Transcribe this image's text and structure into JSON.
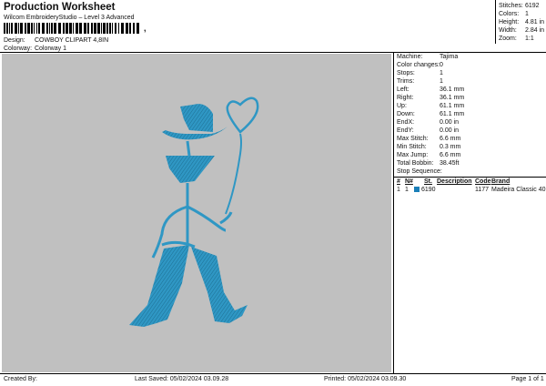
{
  "header": {
    "title": "Production Worksheet",
    "subtitle": "Wilcom EmbroideryStudio – Level 3 Advanced",
    "barcode_suffix": ","
  },
  "design": {
    "design_label": "Design:",
    "design_value": "COWBOY CLIPART 4,8IN",
    "colorway_label": "Colorway:",
    "colorway_value": "Colorway 1"
  },
  "stats": {
    "stitches_label": "Stitches:",
    "stitches_value": "6192",
    "colors_label": "Colors:",
    "colors_value": "1",
    "height_label": "Height:",
    "height_value": "4.81 in",
    "width_label": "Width:",
    "width_value": "2.84 in",
    "zoom_label": "Zoom:",
    "zoom_value": "1:1"
  },
  "info": [
    {
      "label": "Machine:",
      "value": "Tajima"
    },
    {
      "label": "Color changes:",
      "value": "0"
    },
    {
      "label": "Stops:",
      "value": "1"
    },
    {
      "label": "Trims:",
      "value": "1"
    },
    {
      "label": "Left:",
      "value": "36.1 mm"
    },
    {
      "label": "Right:",
      "value": "36.1 mm"
    },
    {
      "label": "Up:",
      "value": "61.1 mm"
    },
    {
      "label": "Down:",
      "value": "61.1 mm"
    },
    {
      "label": "EndX:",
      "value": "0.00 in"
    },
    {
      "label": "EndY:",
      "value": "0.00 in"
    },
    {
      "label": "Max Stitch:",
      "value": "6.6 mm"
    },
    {
      "label": "Min Stitch:",
      "value": "0.3 mm"
    },
    {
      "label": "Max Jump:",
      "value": "6.6 mm"
    },
    {
      "label": "Total Bobbin:",
      "value": "38.45ft"
    }
  ],
  "sequence": {
    "title": "Stop Sequence:",
    "headers": {
      "stop": "#",
      "n": "N#",
      "st": "St.",
      "description": "Description",
      "code": "Code",
      "brand": "Brand"
    },
    "rows": [
      {
        "stop": "1",
        "n": "1",
        "color": "#1a7fb8",
        "st": "6190",
        "description": "",
        "code": "1177",
        "brand": "Madeira Classic 40"
      }
    ]
  },
  "footer": {
    "created_by": "Created By:",
    "last_saved": "Last Saved: 05/02/2024 03.09.28",
    "printed": "Printed: 05/02/2024 03.09.30",
    "page": "Page 1 of 1"
  },
  "colors": {
    "thread": "#2f97c4",
    "thread_dark": "#1d6f93",
    "canvas": "#c0c0c0"
  }
}
